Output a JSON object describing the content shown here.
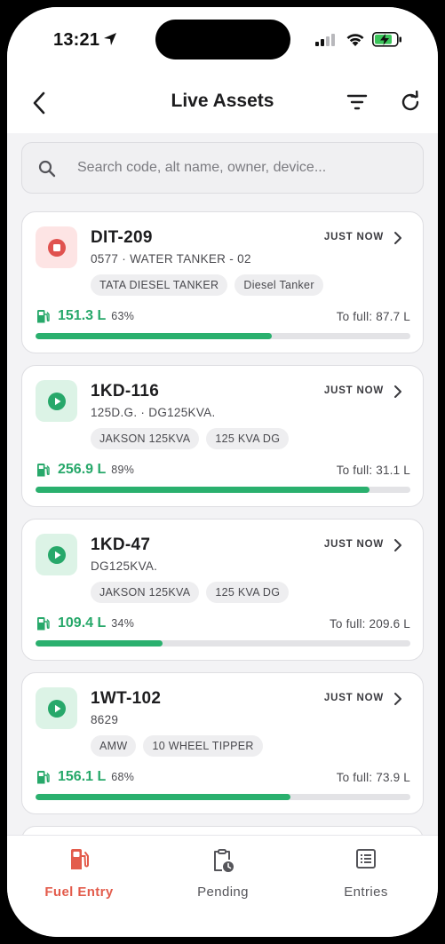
{
  "status_bar": {
    "time": "13:21"
  },
  "header": {
    "title": "Live Assets"
  },
  "search": {
    "placeholder": "Search code, alt name, owner, device..."
  },
  "colors": {
    "accent": "#e35c4c",
    "fuel_green": "#27a86a",
    "stopped": "#e0524f",
    "running": "#27a86a"
  },
  "assets": [
    {
      "code": "DIT-209",
      "subtitle": "0577 · WATER TANKER - 02",
      "status": "stopped",
      "updated": "JUST NOW",
      "tags": [
        "TATA DIESEL TANKER",
        "Diesel Tanker"
      ],
      "fuel": "151.3 L",
      "pct": "63%",
      "fill": 0.63,
      "to_full": "To full: 87.7 L"
    },
    {
      "code": "1KD-116",
      "subtitle": "125D.G. · DG125KVA.",
      "status": "running",
      "updated": "JUST NOW",
      "tags": [
        "JAKSON 125KVA",
        "125 KVA DG"
      ],
      "fuel": "256.9 L",
      "pct": "89%",
      "fill": 0.89,
      "to_full": "To full: 31.1 L"
    },
    {
      "code": "1KD-47",
      "subtitle": "DG125KVA.",
      "status": "running",
      "updated": "JUST NOW",
      "tags": [
        "JAKSON 125KVA",
        "125 KVA DG"
      ],
      "fuel": "109.4 L",
      "pct": "34%",
      "fill": 0.34,
      "to_full": "To full: 209.6 L"
    },
    {
      "code": "1WT-102",
      "subtitle": "8629",
      "status": "running",
      "updated": "JUST NOW",
      "tags": [
        "AMW",
        "10 WHEEL TIPPER"
      ],
      "fuel": "156.1 L",
      "pct": "68%",
      "fill": 0.68,
      "to_full": "To full: 73.9 L"
    }
  ],
  "tabs": [
    {
      "label": "Fuel Entry",
      "icon": "fuel-pump-icon",
      "active": true
    },
    {
      "label": "Pending",
      "icon": "clipboard-clock-icon",
      "active": false
    },
    {
      "label": "Entries",
      "icon": "list-icon",
      "active": false
    }
  ]
}
